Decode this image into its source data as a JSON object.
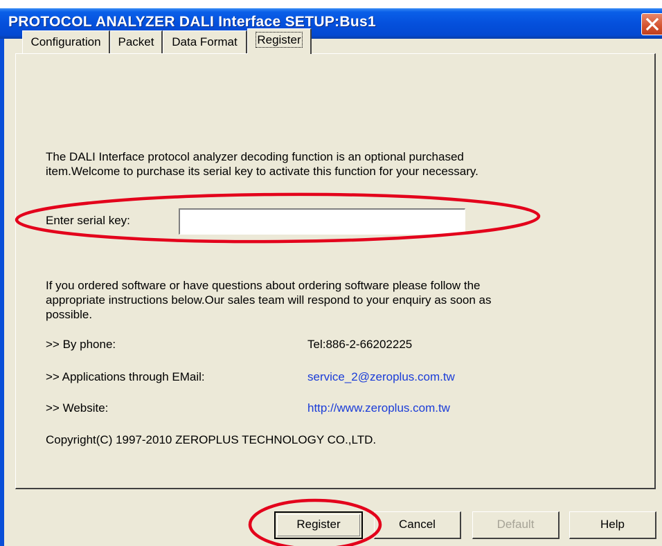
{
  "window": {
    "title": "PROTOCOL ANALYZER DALI Interface SETUP:Bus1"
  },
  "tabs": [
    {
      "label": "Configuration",
      "active": false
    },
    {
      "label": "Packet",
      "active": false
    },
    {
      "label": "Data Format",
      "active": false
    },
    {
      "label": "Register",
      "active": true
    }
  ],
  "register": {
    "intro_line1": "The DALI Interface protocol analyzer decoding function is an optional purchased",
    "intro_line2": "item.Welcome to purchase its serial key to activate this function for your necessary.",
    "serial_label": "Enter serial key:",
    "serial_value": "",
    "order_line1": "If you ordered software or have questions about ordering software please follow the",
    "order_line2": "appropriate instructions below.Our sales team will respond to your enquiry as soon as",
    "order_line3": "possible.",
    "contacts": [
      {
        "label": ">> By phone:",
        "value": "Tel:886-2-66202225"
      },
      {
        "label": ">> Applications through EMail:",
        "value": "service_2@zeroplus.com.tw"
      },
      {
        "label": ">> Website:",
        "value": "http://www.zeroplus.com.tw"
      }
    ],
    "copyright": "Copyright(C) 1997-2010 ZEROPLUS TECHNOLOGY CO.,LTD."
  },
  "buttons": {
    "register": "Register",
    "cancel": "Cancel",
    "default": "Default",
    "help": "Help"
  },
  "colors": {
    "titlebar": "#0550dc",
    "dialog_bg": "#ece9d8",
    "link": "#1a3cd8",
    "annotation": "#e3001b"
  }
}
